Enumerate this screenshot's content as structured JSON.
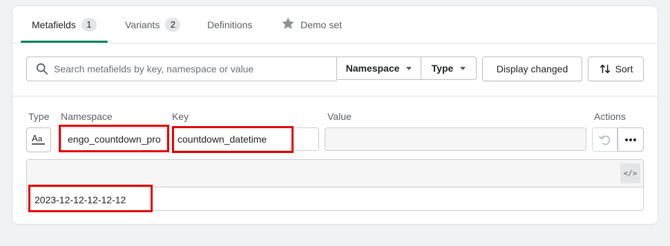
{
  "tabs": [
    {
      "label": "Metafields",
      "count": "1"
    },
    {
      "label": "Variants",
      "count": "2"
    },
    {
      "label": "Definitions"
    },
    {
      "label": "Demo set"
    }
  ],
  "filter": {
    "search_placeholder": "Search metafields by key, namespace or value",
    "namespace_label": "Namespace",
    "type_label": "Type",
    "display_changed_label": "Display changed",
    "sort_label": "Sort"
  },
  "columns": {
    "type": "Type",
    "namespace": "Namespace",
    "key": "Key",
    "value": "Value",
    "actions": "Actions"
  },
  "row": {
    "type_icon": "text-type-icon",
    "namespace": "engo_countdown_pro",
    "key": "countdown_datetime",
    "value": "",
    "editor_content": "2023-12-12-12-12-12"
  },
  "colors": {
    "accent": "#008060",
    "highlight": "#e00000"
  }
}
